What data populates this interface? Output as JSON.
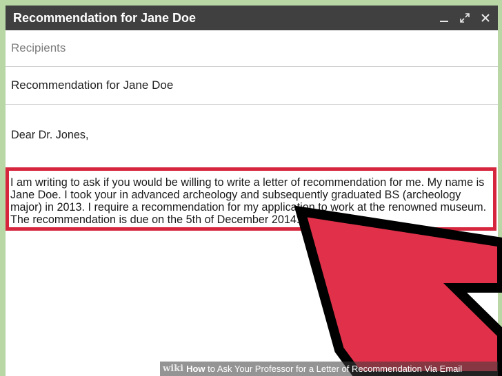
{
  "window": {
    "title": "Recommendation for Jane Doe",
    "controls": {
      "minimize_icon": "minimize-icon",
      "expand_icon": "expand-icon",
      "close_icon": "close-icon"
    }
  },
  "compose": {
    "recipients_placeholder": "Recipients",
    "subject": "Recommendation for Jane Doe",
    "greeting": "Dear Dr. Jones,",
    "paragraph": " I am writing to ask if you would be willing to write a letter of recommendation for me. My name is Jane Doe. I took your in advanced archeology and subsequently graduated BS (archeology major) in 2013. I require a recommendation for my application to work at the renowned museum. The recommendation is due on the 5th of December 2014."
  },
  "overlay": {
    "highlight_color": "#d6263e",
    "arrow_color": "#e1314a",
    "arrow_icon": "pointer-arrow-icon"
  },
  "footer": {
    "logo": "wiki",
    "title_bold": "How",
    "title_rest": " to Ask Your Professor for a Letter of Recommendation Via Email"
  },
  "colors": {
    "titlebar": "#404040",
    "background": "#b9d7a5"
  }
}
